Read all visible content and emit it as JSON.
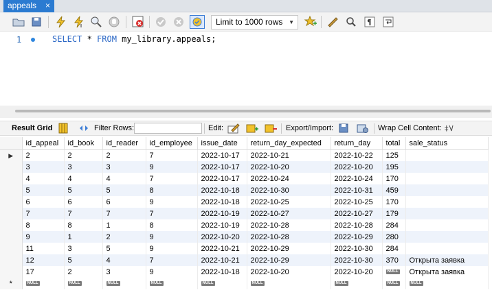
{
  "tab": {
    "title": "appeals",
    "close": "×"
  },
  "toolbar": {
    "limit_value": "Limit to 1000 rows",
    "icons": [
      "open-folder-icon",
      "save-icon",
      "execute-icon",
      "execute-current-icon",
      "explain-icon",
      "stop-icon",
      "toggle-error-icon",
      "commit-icon",
      "rollback-icon",
      "autocommit-icon",
      "bookmark-icon",
      "beautify-icon",
      "find-icon",
      "invisibles-icon",
      "wrap-icon"
    ]
  },
  "editor": {
    "line_number": "1",
    "tokens": [
      {
        "t": "SELECT",
        "k": "kw"
      },
      {
        "t": " * ",
        "k": "id"
      },
      {
        "t": "FROM",
        "k": "kw"
      },
      {
        "t": " my_library.appeals;",
        "k": "id"
      }
    ]
  },
  "results_toolbar": {
    "result_grid_label": "Result Grid",
    "filter_label": "Filter Rows:",
    "filter_value": "",
    "edit_label": "Edit:",
    "export_label": "Export/Import:",
    "wrap_label": "Wrap Cell Content:"
  },
  "grid": {
    "columns": [
      "id_appeal",
      "id_book",
      "id_reader",
      "id_employee",
      "issue_date",
      "return_day_expected",
      "return_day",
      "total",
      "sale_status"
    ],
    "column_widths": [
      61,
      56,
      63,
      75,
      72,
      122,
      75,
      34,
      120
    ],
    "rows": [
      [
        "2",
        "2",
        "2",
        "7",
        "2022-10-17",
        "2022-10-21",
        "2022-10-22",
        "125",
        ""
      ],
      [
        "3",
        "3",
        "3",
        "9",
        "2022-10-17",
        "2022-10-20",
        "2022-10-20",
        "195",
        ""
      ],
      [
        "4",
        "4",
        "4",
        "7",
        "2022-10-17",
        "2022-10-24",
        "2022-10-24",
        "170",
        ""
      ],
      [
        "5",
        "5",
        "5",
        "8",
        "2022-10-18",
        "2022-10-30",
        "2022-10-31",
        "459",
        ""
      ],
      [
        "6",
        "6",
        "6",
        "9",
        "2022-10-18",
        "2022-10-25",
        "2022-10-25",
        "170",
        ""
      ],
      [
        "7",
        "7",
        "7",
        "7",
        "2022-10-19",
        "2022-10-27",
        "2022-10-27",
        "179",
        ""
      ],
      [
        "8",
        "8",
        "1",
        "8",
        "2022-10-19",
        "2022-10-28",
        "2022-10-28",
        "284",
        ""
      ],
      [
        "9",
        "1",
        "2",
        "9",
        "2022-10-20",
        "2022-10-28",
        "2022-10-29",
        "280",
        ""
      ],
      [
        "11",
        "3",
        "5",
        "9",
        "2022-10-21",
        "2022-10-29",
        "2022-10-30",
        "284",
        ""
      ],
      [
        "12",
        "5",
        "4",
        "7",
        "2022-10-21",
        "2022-10-29",
        "2022-10-30",
        "370",
        "Открыта заявка"
      ],
      [
        "17",
        "2",
        "3",
        "9",
        "2022-10-18",
        "2022-10-20",
        "2022-10-20",
        "NULL",
        "Открыта заявка"
      ]
    ],
    "null_label": "NULL",
    "new_row_marker": "*"
  }
}
